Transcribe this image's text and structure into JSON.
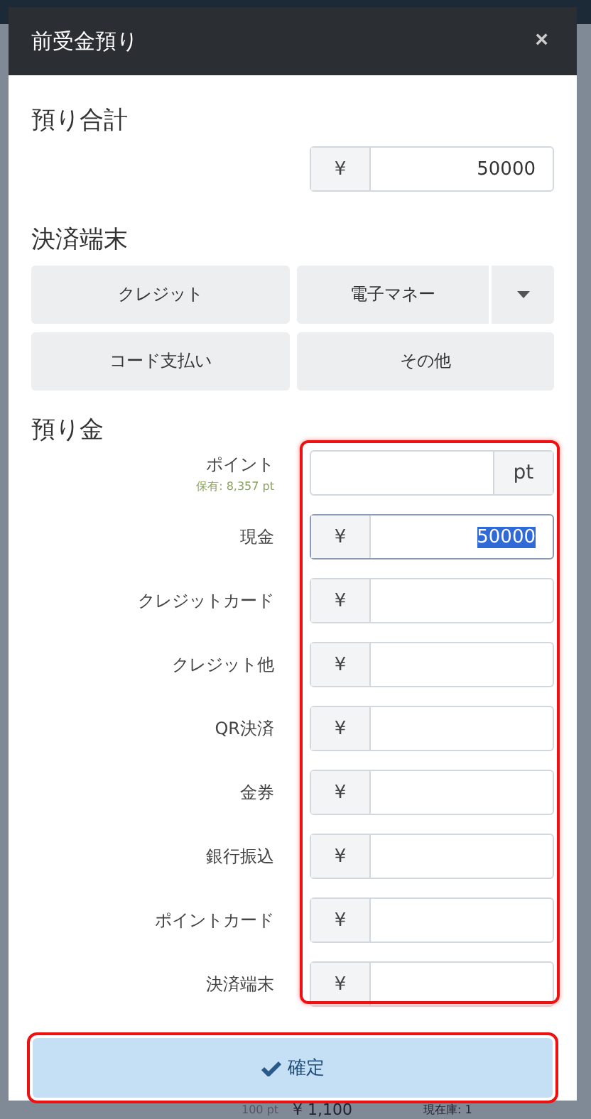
{
  "dialog": {
    "title": "前受金預り",
    "close": "×"
  },
  "total": {
    "label": "預り合計",
    "currency": "¥",
    "value": "50000"
  },
  "terminal": {
    "label": "決済端末",
    "options": [
      {
        "label": "クレジット",
        "kind": "plain"
      },
      {
        "label": "電子マネー",
        "kind": "dropdown"
      },
      {
        "label": "コード支払い",
        "kind": "plain"
      },
      {
        "label": "その他",
        "kind": "plain"
      }
    ]
  },
  "deposit": {
    "label": "預り金",
    "fields": [
      {
        "label": "ポイント",
        "note": "保有: 8,357 pt",
        "kind": "suffix",
        "unit": "pt",
        "focused": false
      },
      {
        "label": "現金",
        "kind": "prefix",
        "unit": "¥",
        "value": "50000",
        "focused": true
      },
      {
        "label": "クレジットカード",
        "kind": "prefix",
        "unit": "¥",
        "focused": false
      },
      {
        "label": "クレジット他",
        "kind": "prefix",
        "unit": "¥",
        "focused": false
      },
      {
        "label": "QR決済",
        "kind": "prefix",
        "unit": "¥",
        "focused": false
      },
      {
        "label": "金券",
        "kind": "prefix",
        "unit": "¥",
        "focused": false
      },
      {
        "label": "銀行振込",
        "kind": "prefix",
        "unit": "¥",
        "focused": false
      },
      {
        "label": "ポイントカード",
        "kind": "prefix",
        "unit": "¥",
        "focused": false
      },
      {
        "label": "決済端末",
        "kind": "prefix",
        "unit": "¥",
        "focused": false
      }
    ]
  },
  "confirm": {
    "label": "確定"
  },
  "background": {
    "points": "100 pt",
    "price": "¥ 1,100",
    "stock": "現在庫: 1"
  }
}
